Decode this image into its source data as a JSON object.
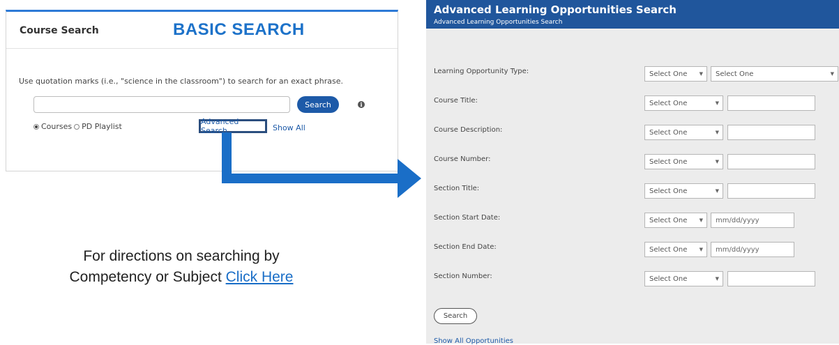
{
  "basic": {
    "title": "Course Search",
    "label": "BASIC SEARCH",
    "instruction": "Use quotation marks (i.e., \"science in the classroom\") to search for an exact phrase.",
    "search_value": "",
    "search_button": "Search",
    "radio_courses": "Courses",
    "radio_playlist": "PD Playlist",
    "advanced_link": "Advanced Search",
    "show_all": "Show All"
  },
  "directions": {
    "line1": "For directions on searching by",
    "line2": "Competency or Subject ",
    "link": "Click Here"
  },
  "advanced": {
    "title": "Advanced Learning Opportunities Search",
    "subtitle": "Advanced Learning Opportunities Search",
    "fields": [
      {
        "label": "Learning Opportunity Type:",
        "select1": "Select One",
        "select2": "Select One"
      },
      {
        "label": "Course Title:",
        "select1": "Select One",
        "value": ""
      },
      {
        "label": "Course Description:",
        "select1": "Select One",
        "value": ""
      },
      {
        "label": "Course Number:",
        "select1": "Select One",
        "value": ""
      },
      {
        "label": "Section Title:",
        "select1": "Select One",
        "value": ""
      },
      {
        "label": "Section Start Date:",
        "select1": "Select One",
        "placeholder": "mm/dd/yyyy"
      },
      {
        "label": "Section End Date:",
        "select1": "Select One",
        "placeholder": "mm/dd/yyyy"
      },
      {
        "label": "Section Number:",
        "select1": "Select One",
        "value": ""
      }
    ],
    "search_button": "Search",
    "show_all": "Show All Opportunities"
  },
  "colors": {
    "accent_blue": "#1d72c9",
    "header_blue": "#20569c",
    "arrow_blue": "#1a6ec7"
  }
}
